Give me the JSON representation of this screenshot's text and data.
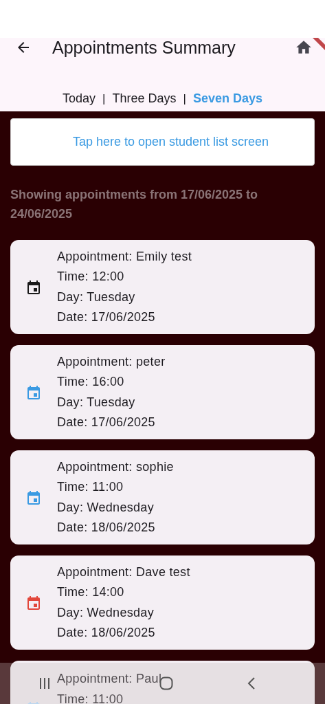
{
  "app_bar": {
    "title": "Appointments Summary"
  },
  "tabs": [
    {
      "label": "Today",
      "selected": false
    },
    {
      "label": "Three Days",
      "selected": false
    },
    {
      "label": "Seven Days",
      "selected": true
    }
  ],
  "tab_separator": "|",
  "student_list_button": {
    "label": "Tap here to open student list screen"
  },
  "range_heading": "Showing appointments from 17/06/2025 to 24/06/2025",
  "appointments": [
    {
      "lines": [
        "Appointment: Emily test",
        "Time: 12:00",
        "Day: Tuesday",
        "Date: 17/06/2025"
      ],
      "color": "#1a1a1a"
    },
    {
      "lines": [
        "Appointment: peter",
        "Time: 16:00",
        "Day: Tuesday",
        "Date: 17/06/2025"
      ],
      "color": "#3a9ae2"
    },
    {
      "lines": [
        "Appointment: sophie",
        "Time: 11:00",
        "Day: Wednesday",
        "Date: 18/06/2025"
      ],
      "color": "#3a9ae2"
    },
    {
      "lines": [
        "Appointment: Dave test",
        "Time: 14:00",
        "Day: Wednesday",
        "Date: 18/06/2025"
      ],
      "color": "#e2473b"
    },
    {
      "lines": [
        "Appointment: Paul",
        "Time: 11:00"
      ],
      "color": "#b9d6f0"
    }
  ]
}
